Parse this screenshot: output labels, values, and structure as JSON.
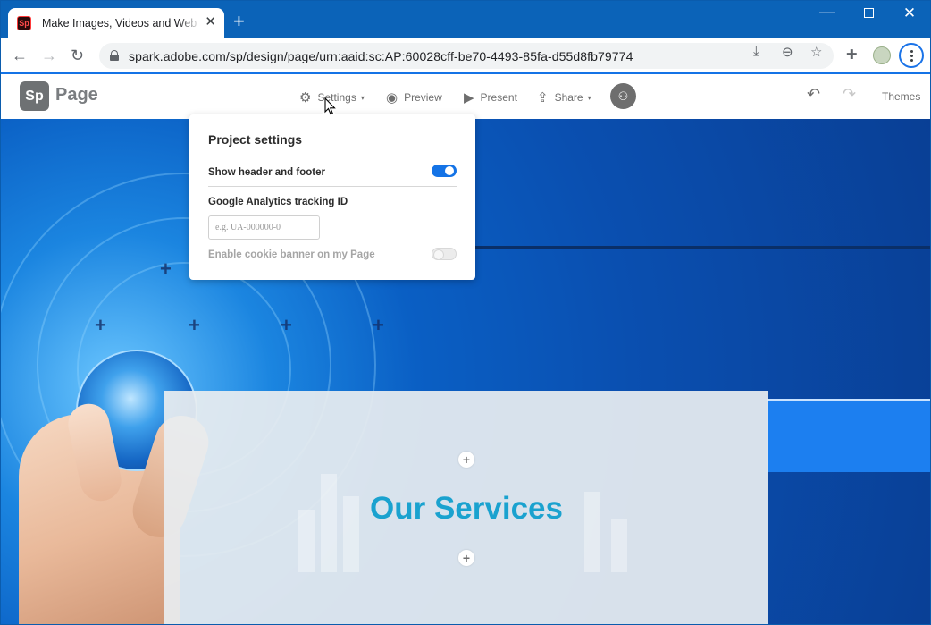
{
  "browser": {
    "tab_title": "Make Images, Videos and Web Stories",
    "favicon_text": "Sp",
    "url": "spark.adobe.com/sp/design/page/urn:aaid:sc:AP:60028cff-be70-4493-85fa-d55d8fb79774"
  },
  "spark": {
    "logo_text": "Sp",
    "app_name": "Page",
    "nav": {
      "settings": "Settings",
      "preview": "Preview",
      "present": "Present",
      "share": "Share",
      "themes": "Themes"
    }
  },
  "settings_popover": {
    "title": "Project settings",
    "show_header_footer_label": "Show header and footer",
    "show_header_footer_on": true,
    "ga_label": "Google Analytics tracking ID",
    "ga_placeholder": "e.g. UA-000000-0",
    "ga_value": "",
    "cookie_banner_label": "Enable cookie banner on my Page",
    "cookie_banner_on": false
  },
  "page_content": {
    "heading": "Our Services"
  },
  "colors": {
    "accent": "#1473e6",
    "heading": "#1aa2cf",
    "browser_frame": "#0b63b8"
  },
  "icons": [
    "favicon-sp",
    "close-icon",
    "plus-icon",
    "minimize-icon",
    "maximize-icon",
    "back-icon",
    "forward-icon",
    "reload-icon",
    "lock-icon",
    "install-icon",
    "zoom-out-icon",
    "star-icon",
    "extensions-icon",
    "gear-icon",
    "eye-icon",
    "play-icon",
    "share-icon",
    "caret-down-icon",
    "add-collaborator-icon",
    "undo-icon",
    "redo-icon"
  ]
}
